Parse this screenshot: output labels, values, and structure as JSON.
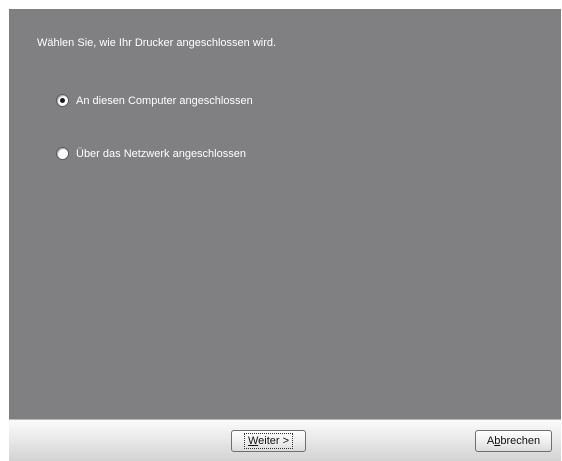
{
  "dialog": {
    "instruction": "Wählen Sie, wie Ihr Drucker angeschlossen wird.",
    "options": [
      {
        "label": "An diesen Computer angeschlossen",
        "selected": true
      },
      {
        "label": "Über das Netzwerk angeschlossen",
        "selected": false
      }
    ]
  },
  "buttons": {
    "next": {
      "mnemonic": "W",
      "rest": "eiter >"
    },
    "cancel": {
      "pre": "A",
      "mnemonic": "b",
      "rest": "brechen"
    }
  },
  "colors": {
    "panel_background": "#808083",
    "text": "#ffffff",
    "button_bar": "#e6e6e6"
  }
}
